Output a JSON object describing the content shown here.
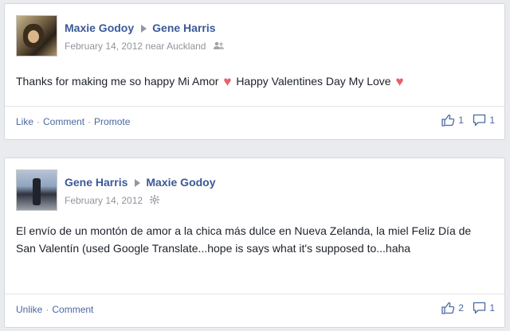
{
  "posts": [
    {
      "author": "Maxie Godoy",
      "recipient": "Gene Harris",
      "date": "February 14, 2012",
      "location_prefix": "near",
      "location": "Auckland",
      "privacy_icon": "friends-icon",
      "message_parts": [
        "Thanks for making me so happy Mi Amor",
        "Happy Valentines Day My Love"
      ],
      "heart_glyph": "♥",
      "actions": [
        "Like",
        "Comment",
        "Promote"
      ],
      "likes": "1",
      "comments": "1"
    },
    {
      "author": "Gene Harris",
      "recipient": "Maxie Godoy",
      "date": "February 14, 2012",
      "privacy_icon": "public-gear-icon",
      "message": "El envío de un montón de amor a la chica más dulce en Nueva Zelanda, la miel Feliz Día de San Valentín (used Google Translate...hope is says what it's supposed to...haha",
      "actions": [
        "Unlike",
        "Comment"
      ],
      "likes": "2",
      "comments": "1"
    }
  ],
  "colors": {
    "link": "#3b5998",
    "meta": "#90949c",
    "heart": "#e8606c",
    "background": "#e9ebee"
  }
}
